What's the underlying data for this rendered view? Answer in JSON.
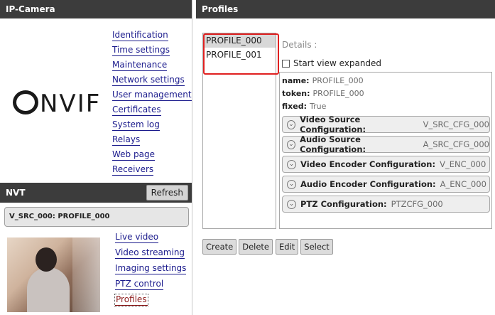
{
  "left_panel": {
    "title": "IP-Camera",
    "logo_text": "NVIF",
    "menu": [
      "Identification",
      "Time settings",
      "Maintenance",
      "Network settings",
      "User management",
      "Certificates",
      "System log",
      "Relays",
      "Web page",
      "Receivers"
    ]
  },
  "nvt": {
    "title": "NVT",
    "refresh_label": "Refresh",
    "profile_label": "V_SRC_000: PROFILE_000",
    "submenu": [
      "Live video",
      "Video streaming",
      "Imaging settings",
      "PTZ control",
      "Profiles"
    ],
    "active_item": "Profiles"
  },
  "profiles": {
    "title": "Profiles",
    "list": [
      "PROFILE_000",
      "PROFILE_001"
    ],
    "selected": "PROFILE_000",
    "details_label": "Details :",
    "start_expanded_label": "Start view expanded",
    "name_key": "name:",
    "name_value": "PROFILE_000",
    "token_key": "token:",
    "token_value": "PROFILE_000",
    "fixed_key": "fixed:",
    "fixed_value": "True",
    "configs": [
      {
        "label": "Video Source Configuration:",
        "value": "V_SRC_CFG_000"
      },
      {
        "label": "Audio Source Configuration:",
        "value": "A_SRC_CFG_000"
      },
      {
        "label": "Video Encoder Configuration:",
        "value": "V_ENC_000"
      },
      {
        "label": "Audio Encoder Configuration:",
        "value": "A_ENC_000"
      },
      {
        "label": "PTZ Configuration:",
        "value": "PTZCFG_000"
      }
    ],
    "buttons": [
      "Create",
      "Delete",
      "Edit",
      "Select"
    ]
  },
  "colors": {
    "header_bg": "#3c3c3c",
    "link": "#1a1a8c",
    "highlight_box": "#e02020"
  }
}
